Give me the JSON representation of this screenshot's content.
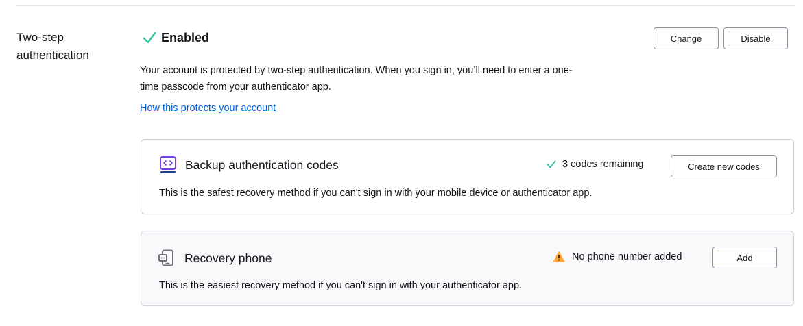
{
  "section": {
    "label": "Two-step authentication",
    "status": "Enabled",
    "status_icon": "check-icon",
    "change_label": "Change",
    "disable_label": "Disable",
    "description": "Your account is protected by two-step authentication. When you sign in, you’ll need to enter a one-time passcode from your authenticator app.",
    "link_text": "How this protects your account"
  },
  "backup_codes": {
    "icon": "backup-codes-icon",
    "title": "Backup authentication codes",
    "status": "3 codes remaining",
    "status_icon": "check-icon",
    "button_label": "Create new codes",
    "description": "This is the safest recovery method if you can't sign in with your mobile device or authenticator app."
  },
  "recovery_phone": {
    "icon": "phone-icon",
    "title": "Recovery phone",
    "status": "No phone number added",
    "status_icon": "warning-icon",
    "button_label": "Add",
    "description": "This is the easiest recovery method if you can't sign in with your authenticator app."
  },
  "colors": {
    "success": "#2ac3a2",
    "warning": "#ffa436",
    "link": "#0060df",
    "icon_purple": "#7542e5"
  }
}
